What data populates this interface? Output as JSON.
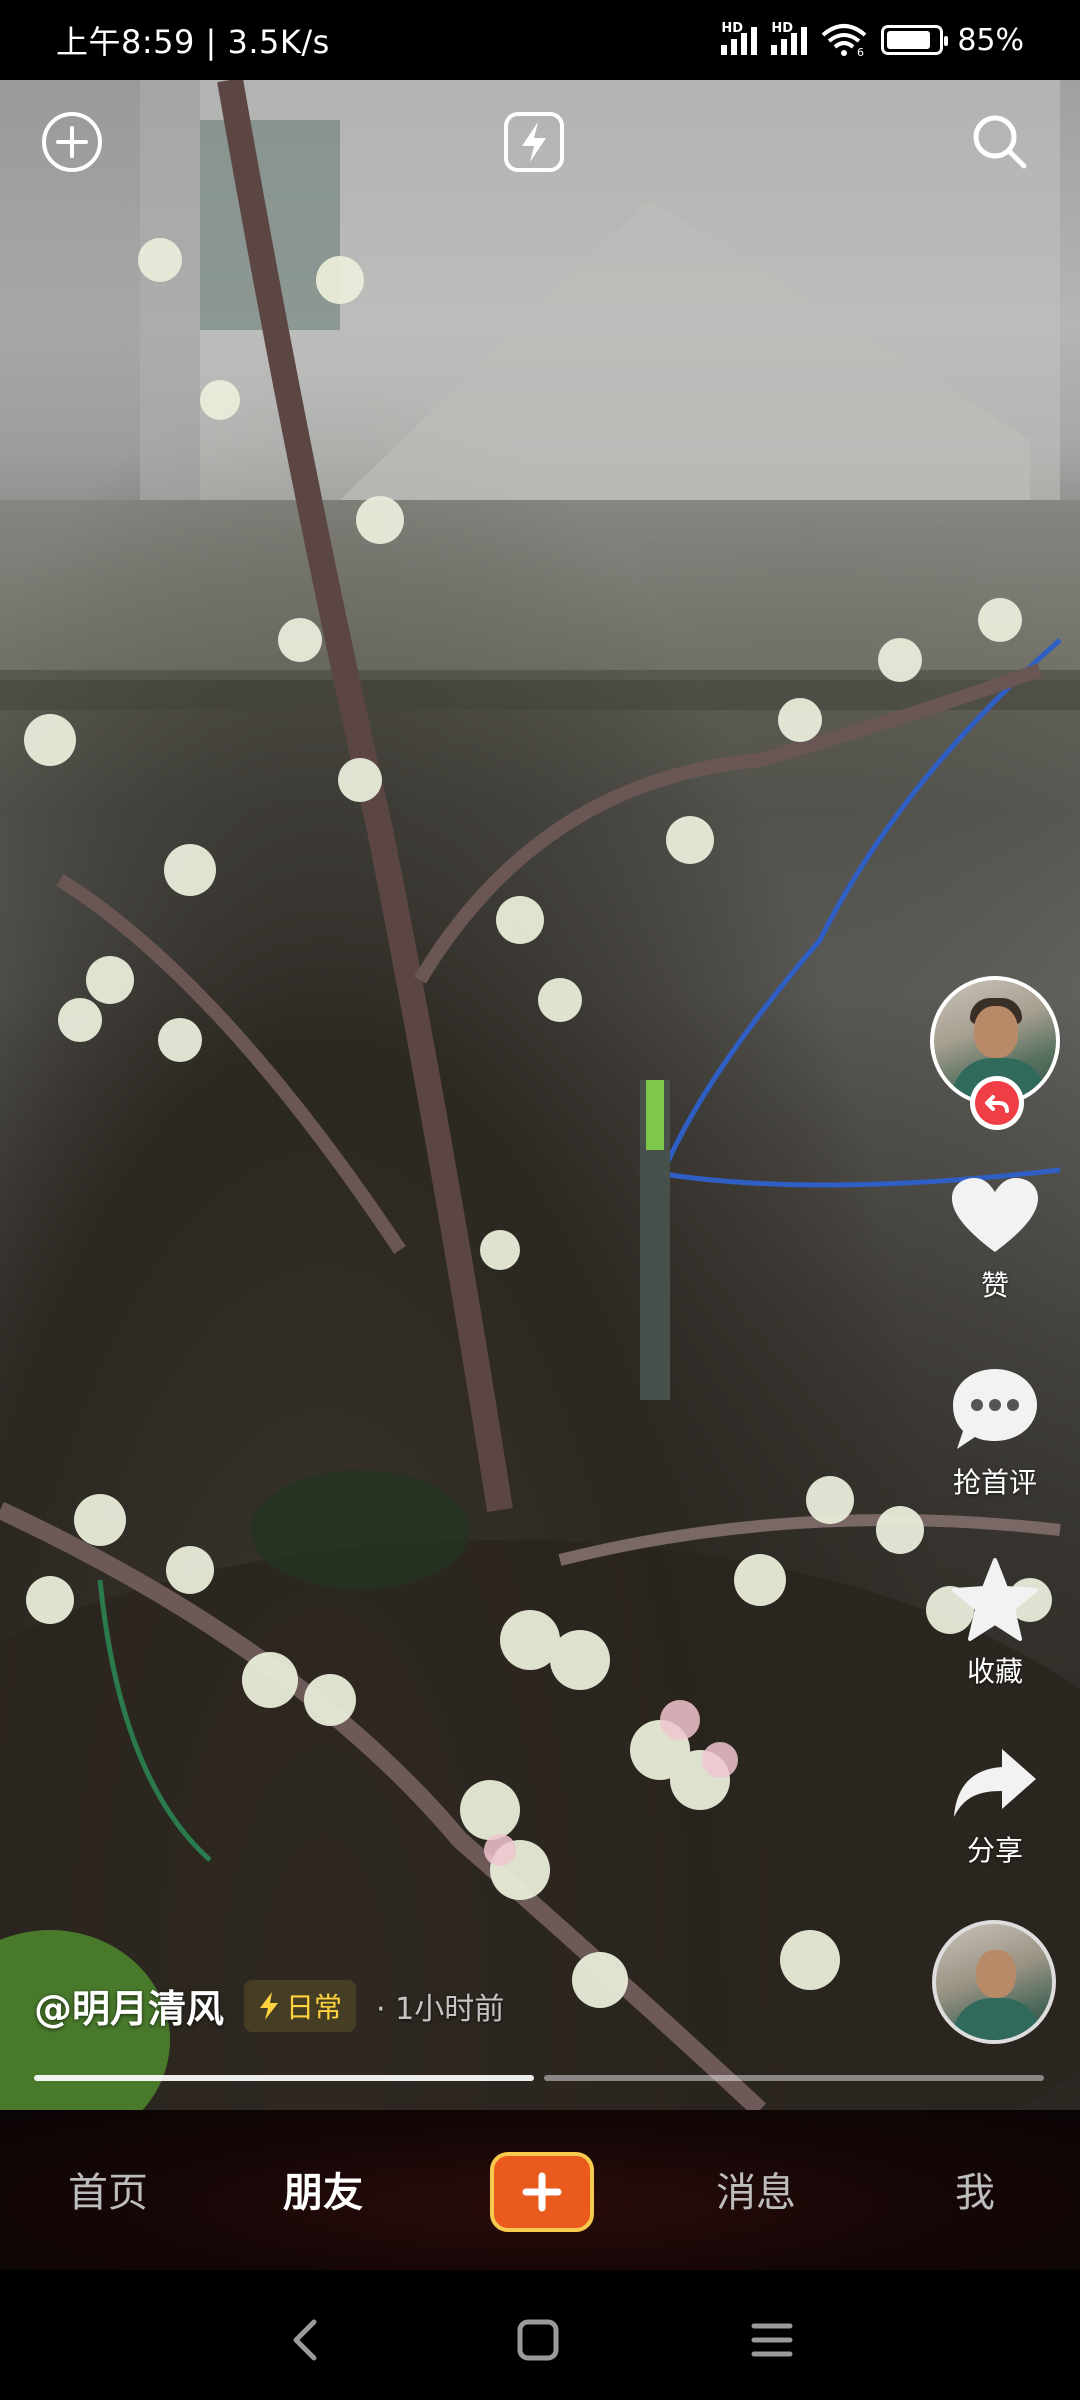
{
  "status_bar": {
    "time_speed": "上午8:59 | 3.5K/s",
    "hd1": "HD",
    "hd2": "HD",
    "wifi_sub": "6",
    "battery_percent": "85%",
    "battery_level": 0.85
  },
  "top_controls": {
    "left_icon": "plus-circle-icon",
    "center_icon": "lightning-icon",
    "right_icon": "search-icon"
  },
  "video": {
    "subject": "flowering branch in planter"
  },
  "right_rail": {
    "like_label": "赞",
    "comment_label": "抢首评",
    "favorite_label": "收藏",
    "share_label": "分享"
  },
  "post": {
    "author": "@明月清风",
    "tag": "日常",
    "time": "· 1小时前"
  },
  "progress": {
    "segments": [
      1.0,
      0.0
    ]
  },
  "bottom_nav": {
    "home": "首页",
    "friends": "朋友",
    "messages": "消息",
    "me": "我"
  },
  "colors": {
    "accent_orange": "#ea5a1c",
    "accent_gold": "#f7c94e",
    "follow_red": "#f03e47"
  }
}
